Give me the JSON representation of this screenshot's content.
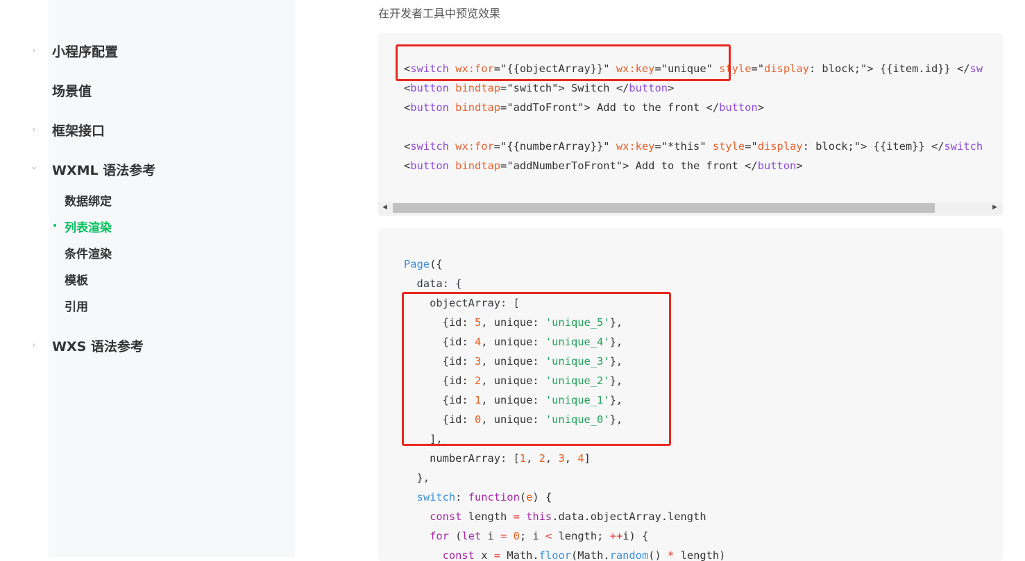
{
  "intro": "在开发者工具中预览效果",
  "sidebar": {
    "items": [
      {
        "label": "小程序配置",
        "arrow": "›"
      },
      {
        "label": "场景值"
      },
      {
        "label": "框架接口",
        "arrow": "›"
      },
      {
        "label": "WXML 语法参考",
        "arrow": "⌄"
      },
      {
        "label": "WXS 语法参考",
        "arrow": "›"
      }
    ],
    "subitems": [
      {
        "label": "数据绑定"
      },
      {
        "label": "列表渲染",
        "active": true
      },
      {
        "label": "条件渲染"
      },
      {
        "label": "模板"
      },
      {
        "label": "引用"
      }
    ]
  },
  "code1": {
    "line1": {
      "a": "<",
      "b": "switch",
      "c": " ",
      "d": "wx:for",
      "e": "=\"{{objectArray}}\" ",
      "f": "wx:key",
      "g": "=\"unique\" ",
      "h": "style",
      "i": "=\"",
      "j": "display",
      "k": ": block;\"> {{item.id}} </",
      "l": "sw"
    },
    "line2": {
      "a": "<",
      "b": "button",
      "c": " ",
      "d": "bindtap",
      "e": "=\"switch\"> Switch </",
      "f": "button",
      "g": ">"
    },
    "line3": {
      "a": "<",
      "b": "button",
      "c": " ",
      "d": "bindtap",
      "e": "=\"addToFront\"> Add to the front </",
      "f": "button",
      "g": ">"
    },
    "line4": {
      "a": "<",
      "b": "switch",
      "c": " ",
      "d": "wx:for",
      "e": "=\"{{numberArray}}\" ",
      "f": "wx:key",
      "g": "=\"*this\" ",
      "h": "style",
      "i": "=\"",
      "j": "display",
      "k": ": block;\"> {{item}} </",
      "l": "switch"
    },
    "line5": {
      "a": "<",
      "b": "button",
      "c": " ",
      "d": "bindtap",
      "e": "=\"addNumberToFront\"> Add to the front </",
      "f": "button",
      "g": ">"
    }
  },
  "code2": {
    "l1": {
      "a": "Page",
      "b": "({"
    },
    "l2": "  data: {",
    "l3": "    objectArray: [",
    "rows": [
      {
        "id": "5",
        "u": "'unique_5'"
      },
      {
        "id": "4",
        "u": "'unique_4'"
      },
      {
        "id": "3",
        "u": "'unique_3'"
      },
      {
        "id": "2",
        "u": "'unique_2'"
      },
      {
        "id": "1",
        "u": "'unique_1'"
      },
      {
        "id": "0",
        "u": "'unique_0'"
      }
    ],
    "row_prefix": "      {id: ",
    "row_mid": ", unique: ",
    "row_suffix": "},",
    "l10": "    ],",
    "l11": {
      "a": "    numberArray: [",
      "n1": "1",
      "s1": ", ",
      "n2": "2",
      "s2": ", ",
      "n3": "3",
      "s3": ", ",
      "n4": "4",
      "b": "]"
    },
    "l12": "  },",
    "l13": {
      "pre": "  ",
      "a": "switch",
      "b": ": ",
      "c": "function",
      "d": "(",
      "e": "e",
      "f": ") {"
    },
    "l14": {
      "pre": "    ",
      "a": "const",
      "b": " length ",
      "c": "=",
      "d": " ",
      "e": "this",
      "f": ".data.objectArray.length"
    },
    "l15": {
      "pre": "    ",
      "a": "for",
      "b": " (",
      "c": "let",
      "d": " i ",
      "e": "=",
      "f": " ",
      "g": "0",
      "h": "; i ",
      "i": "<",
      "j": " length; ",
      "k": "++",
      "l": "i) {"
    },
    "l16": {
      "pre": "      ",
      "a": "const",
      "b": " x ",
      "c": "=",
      "d": " Math.",
      "e": "floor",
      "f": "(Math.",
      "g": "random",
      "h": "() ",
      "i": "*",
      "j": " length)"
    }
  },
  "scroll": {
    "left": "◀",
    "right": "▶"
  }
}
